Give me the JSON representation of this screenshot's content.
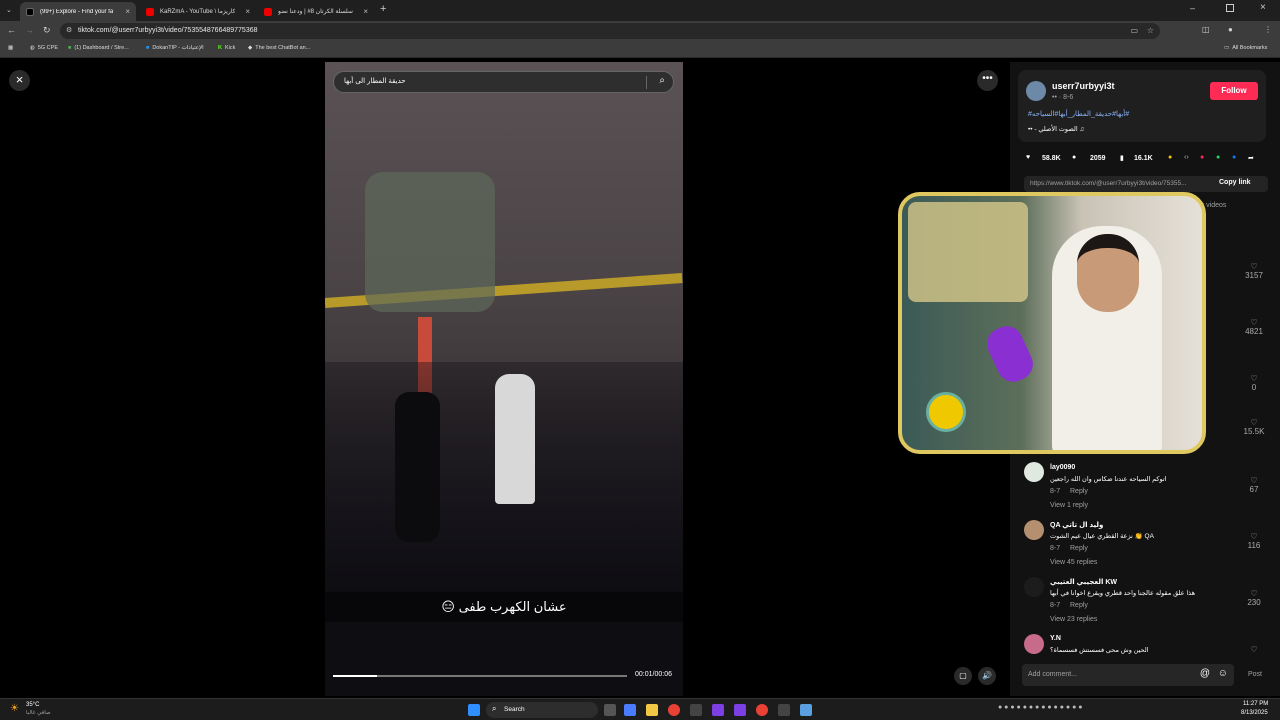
{
  "browser": {
    "tabs": [
      {
        "label": "(99+) Explore - Find your fa",
        "active": true
      },
      {
        "label": "KaRZmA - YouTube \\ كاريزما",
        "active": false
      },
      {
        "label": "سلسلة الكرتان 8# | ودعنا نضو",
        "active": false
      }
    ],
    "url": "tiktok.com/@userr7urbyyi3t/video/7535548766489775368",
    "bookmarks": [
      "5G CPE",
      "(1) Dashboard / Stre...",
      "DokanTIP - الإعتيادات",
      "Kick",
      "The best ChatBot an..."
    ],
    "all_bookmarks": "All Bookmarks"
  },
  "video": {
    "search_value": "حديقة المطار الى أبها",
    "caption": "عشان الكهرب طفى 😑",
    "time": "00:01/00:06",
    "progress": 0.15
  },
  "author": {
    "username": "userr7urbyyi3t",
    "sub": "•• · 8-6",
    "follow": "Follow",
    "hashtags": "#أبها#حديقة_المطار_أبها#السياحه#",
    "sound": "•• - الصوت الأصلي ♫",
    "likes": "58.8K",
    "comments": "2059",
    "saves": "16.1K",
    "link": "https://www.tiktok.com/@userr7urbyyi3t/video/75355...",
    "copy_link": "Copy link",
    "creator_videos_partial": "or videos"
  },
  "side_likes": [
    "3157",
    "4821",
    "0",
    "15.5K"
  ],
  "comments": [
    {
      "user": "lay0090",
      "text": "اتوكم السياحه عندنا ضكاس وان الله راجعين",
      "date": "8-7",
      "reply": "Reply",
      "more": "View 1 reply",
      "likes": "67"
    },
    {
      "user": "QA وليد ال تاتي",
      "text": "QA 👏 نزعة القطري عيال عيم الشوت",
      "date": "8-7",
      "reply": "Reply",
      "more": "View 45 replies",
      "likes": "116"
    },
    {
      "user": "العجيبي العتيبي KW",
      "text": "هذا علق مقوله عالجنا واحد قطري ويقرع اخوانا في أبها",
      "date": "8-7",
      "reply": "Reply",
      "more": "View 23 replies",
      "likes": "230"
    },
    {
      "user": "Y.N",
      "text": "الحين وش محى فسستش فسسماة؟",
      "date": "",
      "reply": "",
      "more": "",
      "likes": ""
    }
  ],
  "add_comment": "Add comment...",
  "post": "Post",
  "taskbar": {
    "weather_temp": "35°C",
    "weather_desc": "صافي غالبا",
    "search": "Search",
    "time": "11:27 PM",
    "date": "8/13/2025"
  },
  "colors": {
    "follow": "#fe2c55",
    "frame": "#e0c860",
    "link": "#8ab4f8"
  }
}
